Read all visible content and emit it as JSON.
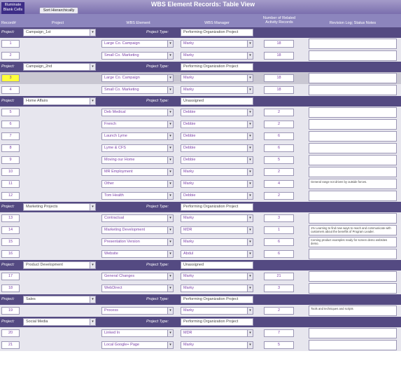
{
  "header": {
    "illuminate_label": "Illuminate Blank Cells",
    "sort_button": "Sort Hierarchically",
    "title": "WBS Element Records: Table View"
  },
  "columns": {
    "record": "Record#",
    "project": "Project",
    "element": "WBS Element",
    "manager": "WBS Manager",
    "related": "Number of Related Activity Records",
    "notes": "Revision Log; Status Notes"
  },
  "labels": {
    "project": "Project:",
    "project_type": "Project Type:"
  },
  "rows": [
    {
      "kind": "group",
      "project": "Campaign_1st",
      "type": "Performing Organization Project"
    },
    {
      "kind": "record",
      "id": "1",
      "element": "Large Co. Campaign",
      "manager": "Marky",
      "count": "18",
      "notes": ""
    },
    {
      "kind": "record",
      "id": "2",
      "element": "Small Co. Marketing",
      "manager": "Marky",
      "count": "18",
      "notes": ""
    },
    {
      "kind": "group",
      "project": "Campaign_2nd",
      "type": "Performing Organization Project"
    },
    {
      "kind": "record",
      "id": "3",
      "element": "Large Co. Campaign",
      "manager": "Marky",
      "count": "18",
      "notes": "",
      "selected": true
    },
    {
      "kind": "record",
      "id": "4",
      "element": "Small Co. Marketing",
      "manager": "Marky",
      "count": "18",
      "notes": ""
    },
    {
      "kind": "group",
      "project": "Home Affairs",
      "type": "Unassigned"
    },
    {
      "kind": "record",
      "id": "5",
      "element": "Deb Medical",
      "manager": "Debbie",
      "count": "2",
      "notes": ""
    },
    {
      "kind": "record",
      "id": "6",
      "element": "French",
      "manager": "Debbie",
      "count": "2",
      "notes": ""
    },
    {
      "kind": "record",
      "id": "7",
      "element": "Launch Lyme",
      "manager": "Debbie",
      "count": "6",
      "notes": ""
    },
    {
      "kind": "record",
      "id": "8",
      "element": "Lyme & CFS",
      "manager": "Debbie",
      "count": "6",
      "notes": ""
    },
    {
      "kind": "record",
      "id": "9",
      "element": "Moving our Home",
      "manager": "Debbie",
      "count": "5",
      "notes": ""
    },
    {
      "kind": "record",
      "id": "10",
      "element": "MR Employment",
      "manager": "Marky",
      "count": "2",
      "notes": ""
    },
    {
      "kind": "record",
      "id": "11",
      "element": "Other",
      "manager": "Marky",
      "count": "4",
      "notes": "General range not driven by outside forces."
    },
    {
      "kind": "record",
      "id": "12",
      "element": "Tom Health",
      "manager": "Debbie",
      "count": "2",
      "notes": ""
    },
    {
      "kind": "group",
      "project": "Marketing Projects",
      "type": "Performing Organization Project"
    },
    {
      "kind": "record",
      "id": "13",
      "element": "Contractual",
      "manager": "Marky",
      "count": "3",
      "notes": ""
    },
    {
      "kind": "record",
      "id": "14",
      "element": "Marketing Development",
      "manager": "MDR",
      "count": "1",
      "notes": "1% Learning to find new ways to reach and communicate with customers about the benefits of Program Leader."
    },
    {
      "kind": "record",
      "id": "15",
      "element": "Presentation Version",
      "manager": "Marky",
      "count": "6",
      "notes": "Coming product examples ready for screen demo websites demo."
    },
    {
      "kind": "record",
      "id": "16",
      "element": "Website",
      "manager": "Abdul",
      "count": "6",
      "notes": ""
    },
    {
      "kind": "group",
      "project": "Product Development",
      "type": "Unassigned"
    },
    {
      "kind": "record",
      "id": "17",
      "element": "General Changes",
      "manager": "Marky",
      "count": "21",
      "notes": ""
    },
    {
      "kind": "record",
      "id": "18",
      "element": "WebDirect",
      "manager": "Marky",
      "count": "3",
      "notes": ""
    },
    {
      "kind": "group",
      "project": "Sales",
      "type": "Performing Organization Project"
    },
    {
      "kind": "record",
      "id": "19",
      "element": "Process",
      "manager": "Marky",
      "count": "2",
      "notes": "Tools and techniques and scripts"
    },
    {
      "kind": "group",
      "project": "Social Media",
      "type": "Performing Organization Project"
    },
    {
      "kind": "record",
      "id": "20",
      "element": "Linked In",
      "manager": "MDR",
      "count": "7",
      "notes": ""
    },
    {
      "kind": "record",
      "id": "21",
      "element": "Local Google+ Page",
      "manager": "Marky",
      "count": "5",
      "notes": ""
    }
  ],
  "colors": {
    "title_bar": "#8a80bd",
    "group_bar": "#544a82",
    "selected_record": "#ffff3a",
    "text_accent": "#7a3fa8"
  }
}
